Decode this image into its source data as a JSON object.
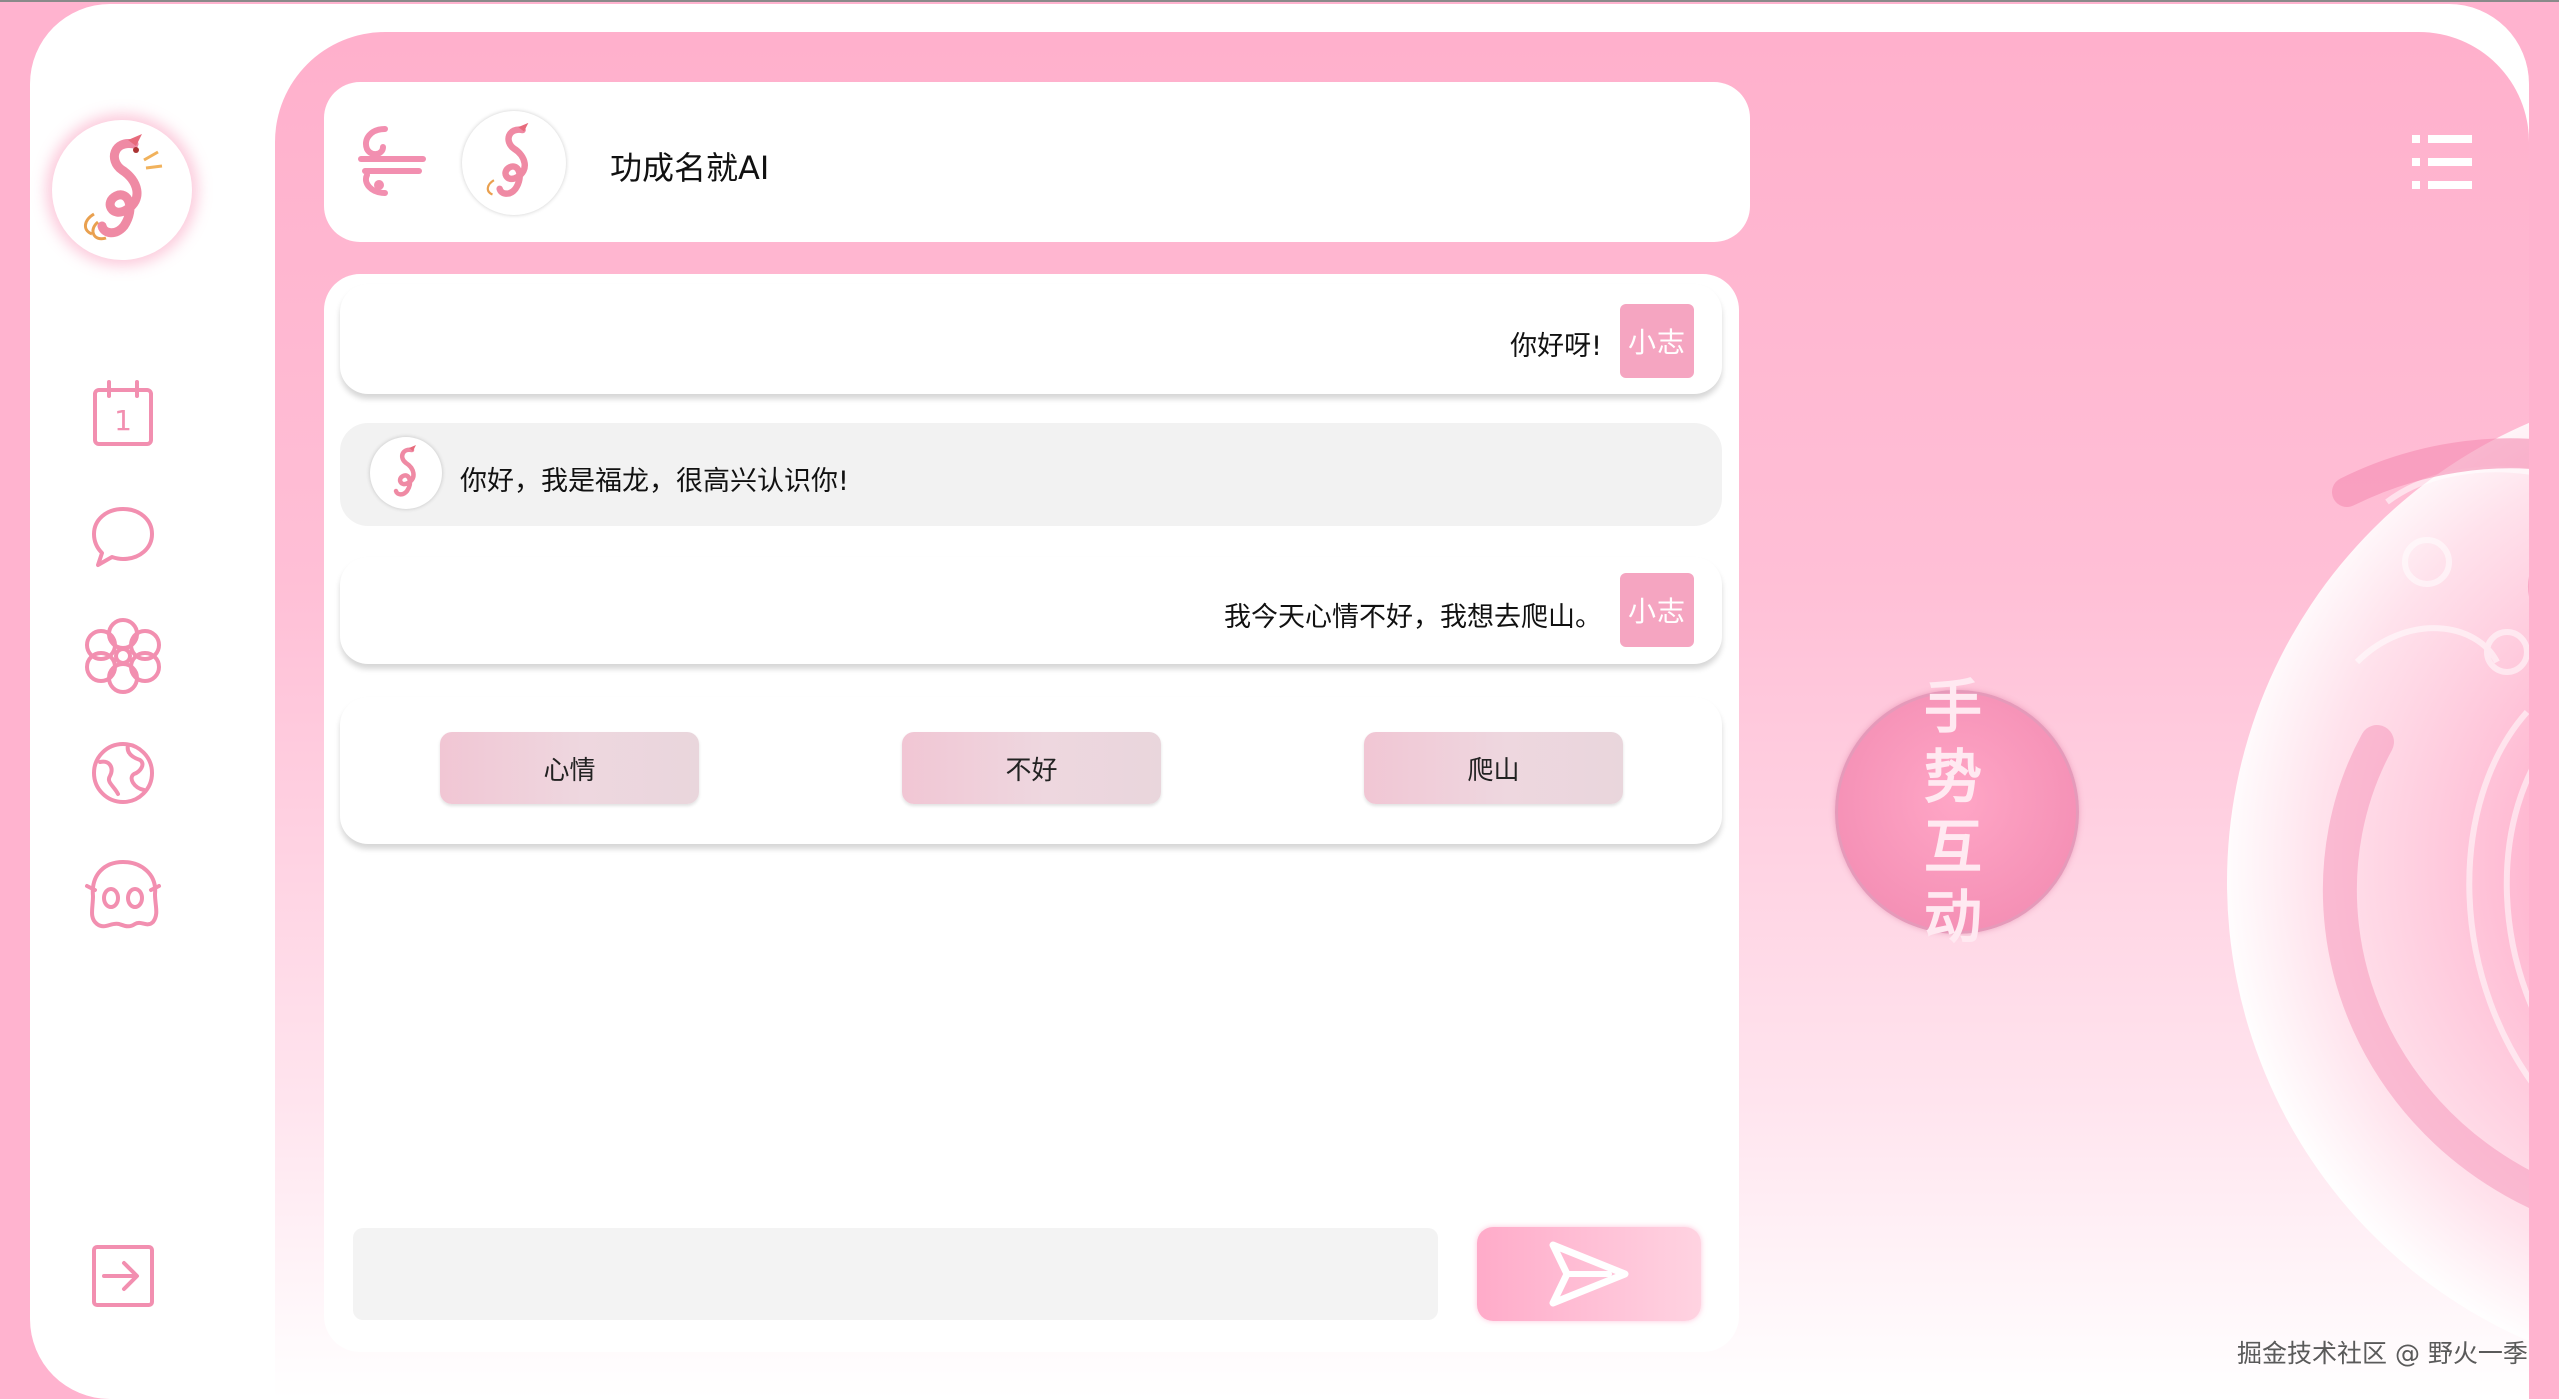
{
  "header": {
    "title": "功成名就AI"
  },
  "nav": {
    "items": [
      {
        "name": "calendar",
        "icon": "calendar-icon",
        "label": "1"
      },
      {
        "name": "chat",
        "icon": "chat-bubble-icon"
      },
      {
        "name": "flower",
        "icon": "flower-icon"
      },
      {
        "name": "globe",
        "icon": "globe-icon"
      },
      {
        "name": "pet",
        "icon": "mascot-face-icon"
      }
    ],
    "logout_icon": "logout-icon"
  },
  "messages": [
    {
      "role": "user",
      "text": "你好呀!",
      "avatar": "小志"
    },
    {
      "role": "bot",
      "text": "你好，我是福龙，很高兴认识你!"
    },
    {
      "role": "user",
      "text": "我今天心情不好，我想去爬山。",
      "avatar": "小志"
    }
  ],
  "keywords": [
    "心情",
    "不好",
    "爬山"
  ],
  "input": {
    "value": "",
    "placeholder": ""
  },
  "gesture_button": {
    "label": "手势\n互动"
  },
  "watermark": "掘金技术社区 @ 野火一季",
  "colors": {
    "accent": "#ffb0cc",
    "brand_pink": "#f5a5c1",
    "icon_pink": "#f28fb0"
  }
}
